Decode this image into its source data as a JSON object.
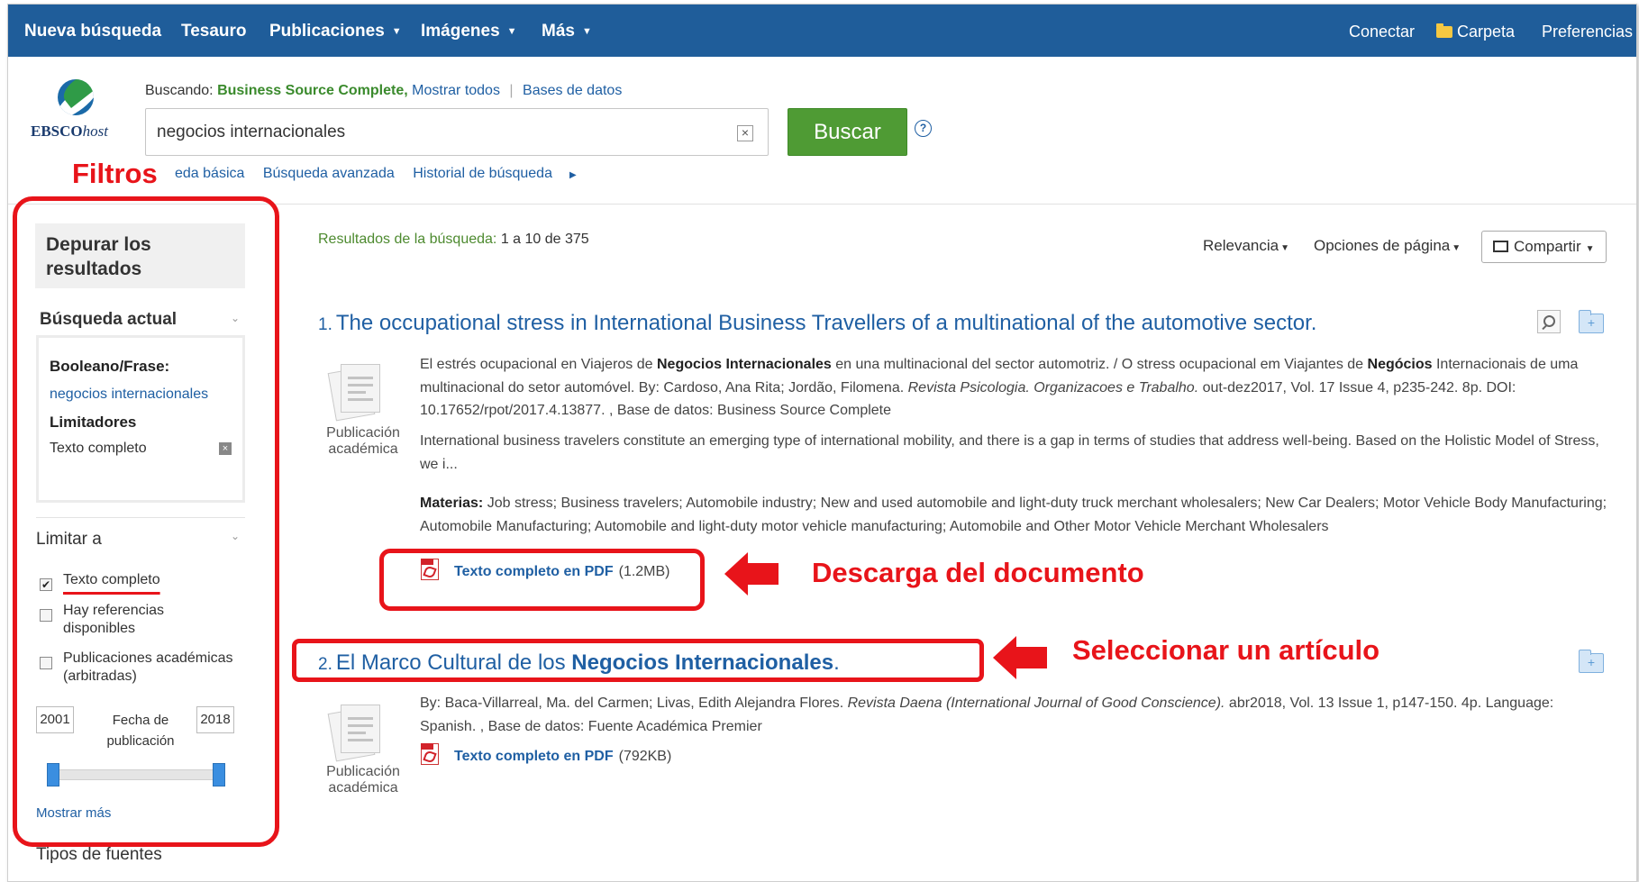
{
  "nav": {
    "items": [
      {
        "label": "Nueva búsqueda",
        "caret": false
      },
      {
        "label": "Tesauro",
        "caret": false
      },
      {
        "label": "Publicaciones",
        "caret": true
      },
      {
        "label": "Imágenes",
        "caret": true
      },
      {
        "label": "Más",
        "caret": true
      }
    ],
    "connect": "Conectar",
    "folder": "Carpeta",
    "preferences": "Preferencias"
  },
  "header": {
    "logo_main": "EBSCO",
    "logo_suffix": "host",
    "searching_label": "Buscando:",
    "database": "Business Source Complete,",
    "show_all": "Mostrar todos",
    "databases_link": "Bases de datos",
    "query": "negocios internacionales",
    "search_button": "Buscar",
    "help": "?",
    "links": {
      "basic": "eda básica",
      "advanced": "Búsqueda avanzada",
      "history": "Historial de búsqueda"
    }
  },
  "annotations": {
    "filters": "Filtros",
    "download": "Descarga del documento",
    "select": "Seleccionar un artículo"
  },
  "sidebar": {
    "refine_title": "Depurar los resultados",
    "current_search": "Búsqueda actual",
    "boolean_label": "Booleano/Frase:",
    "boolean_value": "negocios internacionales",
    "limiters_label": "Limitadores",
    "limiter_fulltext": "Texto completo",
    "limit_to": "Limitar a",
    "checkboxes": [
      {
        "label": "Texto completo",
        "checked": true
      },
      {
        "label": "Hay referencias disponibles",
        "checked": false
      },
      {
        "label": "Publicaciones académicas (arbitradas)",
        "checked": false
      }
    ],
    "year_from": "2001",
    "year_to": "2018",
    "date_label": "Fecha de publicación",
    "show_more": "Mostrar más",
    "source_types": "Tipos de fuentes"
  },
  "results": {
    "count_label": "Resultados de la búsqueda:",
    "count_range": "1 a 10 de 375",
    "sort": "Relevancia",
    "page_options": "Opciones de página",
    "share": "Compartir",
    "items": [
      {
        "number": "1.",
        "title": "The occupational stress in International Business Travellers of a multinational of the automotive sector.",
        "type": "Publicación académica",
        "subjects_label": "Materias:",
        "pdf_label": "Texto completo en PDF",
        "pdf_size": "(1.2MB)"
      },
      {
        "number": "2.",
        "title_prefix": "El Marco Cultural de los ",
        "title_bold": "Negocios Internacionales",
        "title_suffix": ".",
        "type": "Publicación académica",
        "pdf_label": "Texto completo en PDF",
        "pdf_size": "(792KB)"
      }
    ]
  },
  "colors": {
    "nav_bg": "#1f5d9a",
    "link": "#1f5fa3",
    "search_button": "#4f9b34",
    "annotation": "#e8141a",
    "db_name": "#3a8a2c"
  }
}
